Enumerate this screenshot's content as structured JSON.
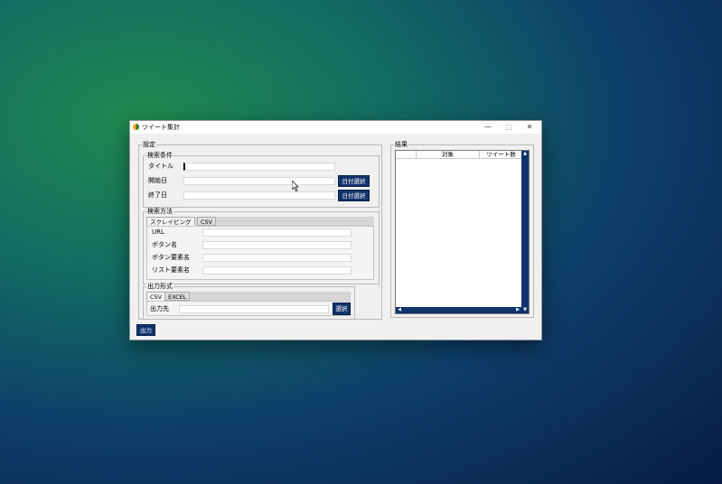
{
  "window": {
    "title": "ツイート集計",
    "minimize": "—",
    "maximize": "□",
    "close": "✕"
  },
  "settings": {
    "group_label": "設定",
    "search_conditions": {
      "label": "検索条件",
      "title_label": "タイトル",
      "start_label": "開始日",
      "end_label": "終了日",
      "date_button": "日付選択"
    },
    "search_method": {
      "label": "検索方法",
      "tabs": [
        "スクレイピング",
        "CSV"
      ],
      "active_tab": 0,
      "fields": [
        "URL",
        "ボタン名",
        "ボタン要素名",
        "リスト要素名"
      ]
    },
    "output_format": {
      "label": "出力形式",
      "tabs": [
        "CSV",
        "EXCEL"
      ],
      "active_tab": 0,
      "dest_label": "出力先",
      "select_button": "選択"
    }
  },
  "results": {
    "group_label": "結果",
    "columns": [
      "",
      "対象",
      "ツイート数"
    ]
  },
  "output_button": "出力",
  "colors": {
    "accent": "#10336b",
    "window_bg": "#f0f0f0"
  }
}
